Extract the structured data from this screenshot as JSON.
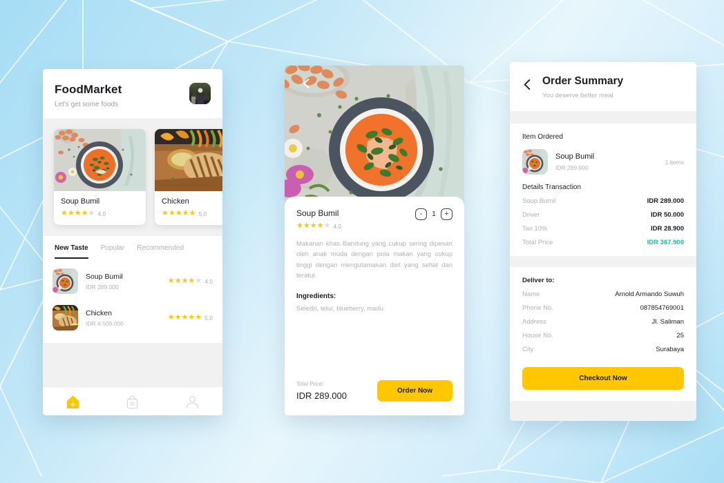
{
  "theme": {
    "accent_yellow": "#FFC700",
    "accent_green": "#1ABC9C",
    "text_dark": "#1B1B22",
    "text_muted": "#B0B0B6",
    "page_bg": "#B7E4F6"
  },
  "home": {
    "title": "FoodMarket",
    "subtitle": "Let's get some foods",
    "avatar_icon": "user-photo-avatar",
    "cards": [
      {
        "name": "Soup Bumil",
        "rating": "4.0",
        "stars_on": 4,
        "stars_off": 1,
        "image": "soup-bowl-photo"
      },
      {
        "name": "Chicken",
        "rating": "5.0",
        "stars_on": 5,
        "stars_off": 0,
        "image": "grilled-chicken-photo"
      }
    ],
    "tabs": [
      {
        "label": "New Taste",
        "active": true
      },
      {
        "label": "Popular",
        "active": false
      },
      {
        "label": "Recommended",
        "active": false
      }
    ],
    "list": [
      {
        "name": "Soup Bumil",
        "price": "IDR 289.000",
        "rating": "4.0",
        "stars_on": 4,
        "stars_off": 1,
        "image": "soup-bowl-photo"
      },
      {
        "name": "Chicken",
        "price": "IDR 4.509.000",
        "rating": "5.0",
        "stars_on": 5,
        "stars_off": 0,
        "image": "grilled-chicken-photo"
      }
    ],
    "nav": [
      {
        "icon": "home-icon",
        "active": true
      },
      {
        "icon": "shopping-bag-icon",
        "active": false
      },
      {
        "icon": "person-icon",
        "active": false
      }
    ]
  },
  "detail": {
    "back_icon": "back-chevron-icon",
    "hero_image": "soup-bowl-photo",
    "name": "Soup Bumil",
    "rating": "4.0",
    "stars_on": 4,
    "stars_off": 1,
    "quantity": "1",
    "minus_label": "-",
    "plus_label": "+",
    "description": "Makanan khas Bandung yang cukup sering dipesan oleh anak muda dengan pola makan yang cukup tinggi dengan mengutamakan diet yang sehat dan teratur.",
    "ingredients_title": "Ingredients:",
    "ingredients": "Seledri, telur, blueberry, madu",
    "total_price_label": "Total Price:",
    "total_price_value": "IDR 289.000",
    "order_button": "Order Now"
  },
  "summary": {
    "back_icon": "back-chevron-icon",
    "title": "Order Summary",
    "subtitle": "You deserve better meal",
    "item_ordered_title": "Item Ordered",
    "item": {
      "name": "Soup Bumil",
      "price": "IDR 289.000",
      "count": "1 items",
      "image": "soup-bowl-photo"
    },
    "details_title": "Details Transaction",
    "details": [
      {
        "label": "Soup Bumil",
        "value": "IDR 289.000",
        "accent": false
      },
      {
        "label": "Driver",
        "value": "IDR 50.000",
        "accent": false
      },
      {
        "label": "Tax 10%",
        "value": "IDR 28.900",
        "accent": false
      },
      {
        "label": "Total Price",
        "value": "IDR 367.900",
        "accent": true
      }
    ],
    "deliver_title": "Deliver to:",
    "deliver": [
      {
        "label": "Name",
        "value": "Arnold Armando Suwuh"
      },
      {
        "label": "Phone No.",
        "value": "087854769001"
      },
      {
        "label": "Address",
        "value": "Jl. Saliman"
      },
      {
        "label": "House No.",
        "value": "25"
      },
      {
        "label": "City",
        "value": "Surabaya"
      }
    ],
    "checkout_button": "Checkout Now"
  }
}
